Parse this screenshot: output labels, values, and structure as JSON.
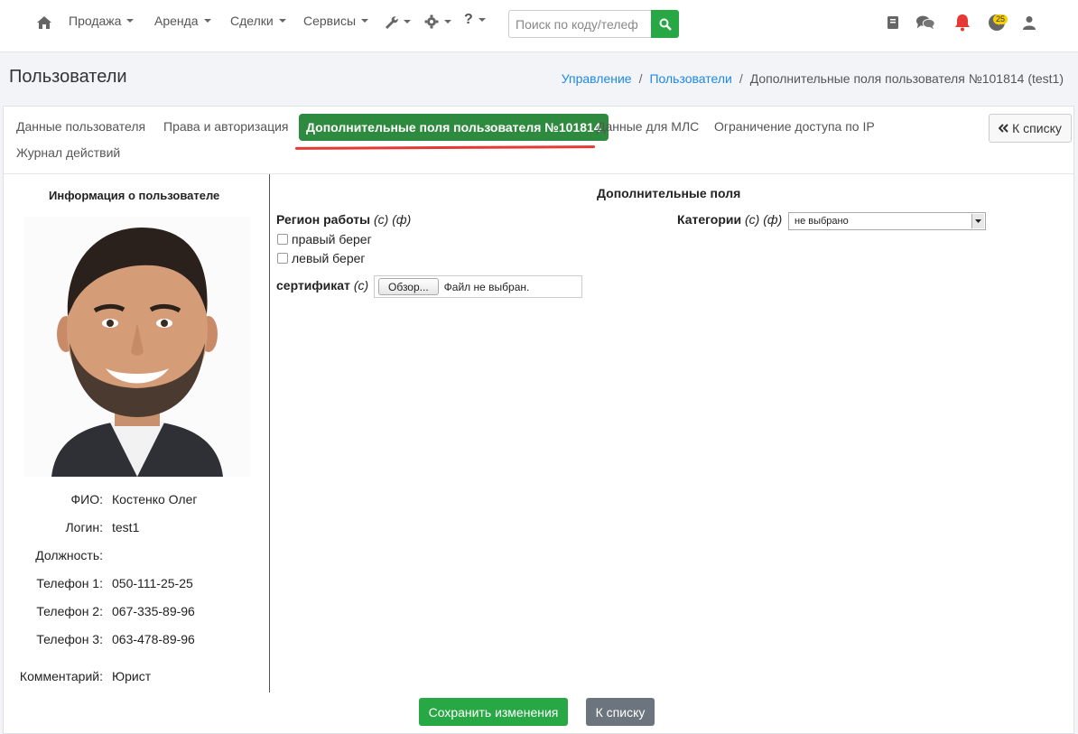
{
  "nav": {
    "home_icon": "home-icon",
    "menus": [
      {
        "label": "Продажа"
      },
      {
        "label": "Аренда"
      },
      {
        "label": "Сделки"
      },
      {
        "label": "Сервисы"
      }
    ],
    "tools_icon": "wrench-icon",
    "settings_icon": "gear-icon",
    "help_label": "?",
    "search_placeholder": "Поиск по коду/телеф",
    "notifications_count": "25"
  },
  "header": {
    "title": "Пользователи",
    "breadcrumb": [
      "Управление",
      "Пользователи",
      "Дополнительные поля пользователя №101814 (test1)"
    ]
  },
  "tabs": {
    "items": [
      "Данные пользователя",
      "Права и авторизация",
      "Дополнительные поля пользователя №101814",
      "Данные для МЛС",
      "Ограничение доступа по IP",
      "Журнал действий"
    ],
    "back_label": "К списку"
  },
  "user_info": {
    "title": "Информация о пользователе",
    "rows": [
      {
        "label": "ФИО:",
        "value": "Костенко Олег"
      },
      {
        "label": "Логин:",
        "value": "test1"
      },
      {
        "label": "Должность:",
        "value": ""
      },
      {
        "label": "Телефон 1:",
        "value": "050-111-25-25"
      },
      {
        "label": "Телефон 2:",
        "value": "067-335-89-96"
      },
      {
        "label": "Телефон 3:",
        "value": "063-478-89-96"
      },
      {
        "label": "Комментарий:",
        "value": "Юрист"
      }
    ]
  },
  "extra_fields": {
    "title": "Дополнительные поля",
    "region_label": "Регион работы",
    "region_flags": "(с) (ф)",
    "region_options": [
      "правый берег",
      "левый берег"
    ],
    "certificate_label": "сертификат",
    "certificate_flags": "(с)",
    "file_button": "Обзор...",
    "file_status": "Файл не выбран.",
    "category_label": "Категории",
    "category_flags": "(с) (ф)",
    "category_value": "не выбрано"
  },
  "actions": {
    "save_label": "Сохранить изменения",
    "back_label": "К списку"
  },
  "colors": {
    "accent_green": "#28a745",
    "active_tab": "#2d8a3e",
    "link_blue": "#1e88e5",
    "underline_red": "#e53935",
    "secondary_gray": "#6c757d"
  }
}
